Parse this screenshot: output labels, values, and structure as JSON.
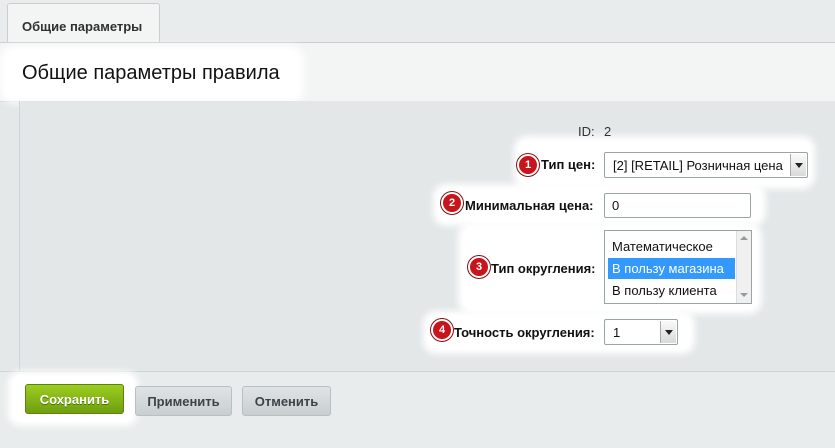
{
  "tabs": [
    {
      "label": "Общие параметры"
    }
  ],
  "page_title": "Общие параметры правила",
  "form": {
    "id": {
      "label": "ID:",
      "value": "2"
    },
    "price_type": {
      "badge": "1",
      "label": "Тип цен:",
      "value": "[2] [RETAIL] Розничная цена"
    },
    "min_price": {
      "badge": "2",
      "label": "Минимальная цена:",
      "value": "0"
    },
    "rounding_type": {
      "badge": "3",
      "label": "Тип округления:",
      "options": [
        "Математическое",
        "В пользу магазина",
        "В пользу клиента"
      ],
      "selected": "В пользу магазина"
    },
    "rounding_precision": {
      "badge": "4",
      "label": "Точность округления:",
      "value": "1"
    }
  },
  "buttons": {
    "save": "Сохранить",
    "apply": "Применить",
    "cancel": "Отменить"
  },
  "colors": {
    "save_green": "#80b316",
    "badge_red": "#c8141b",
    "selection_blue": "#3399ff"
  }
}
